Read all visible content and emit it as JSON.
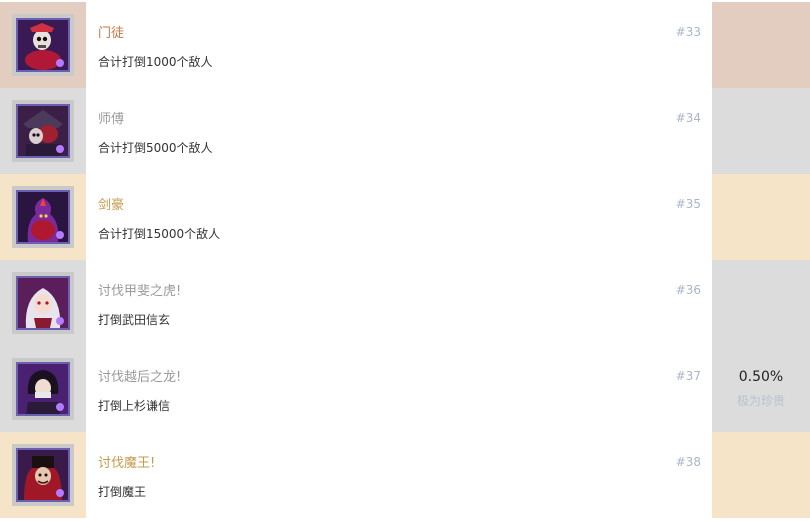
{
  "colors": {
    "bg_copper": "#e3cdc1",
    "bg_silver": "#dcdcdc",
    "bg_gold": "#f6e4c9",
    "title_copper": "#c07a4f",
    "title_silver": "#9a9a9a",
    "title_gold": "#c59a4c",
    "number": "#a9b6c8"
  },
  "achievements": [
    {
      "title": "门徒",
      "desc": "合计打倒1000个敌人",
      "number": "#33",
      "tier": "copper",
      "icon": "skull-warrior-icon"
    },
    {
      "title": "师傅",
      "desc": "合计打倒5000个敌人",
      "number": "#34",
      "tier": "silver",
      "icon": "hooded-demon-icon"
    },
    {
      "title": "剑豪",
      "desc": "合计打倒15000个敌人",
      "number": "#35",
      "tier": "gold",
      "icon": "flame-demon-icon"
    },
    {
      "title": "讨伐甲斐之虎!",
      "desc": "打倒武田信玄",
      "number": "#36",
      "tier": "silver",
      "icon": "white-haired-warrior-icon"
    },
    {
      "title": "讨伐越后之龙!",
      "desc": "打倒上杉谦信",
      "number": "#37",
      "tier": "silver",
      "icon": "masked-dark-warrior-icon"
    },
    {
      "title": "讨伐魔王!",
      "desc": "打倒魔王",
      "number": "#38",
      "tier": "gold",
      "icon": "demon-king-icon"
    }
  ],
  "rarity": {
    "percent": "0.50%",
    "label": "极为珍贵"
  }
}
